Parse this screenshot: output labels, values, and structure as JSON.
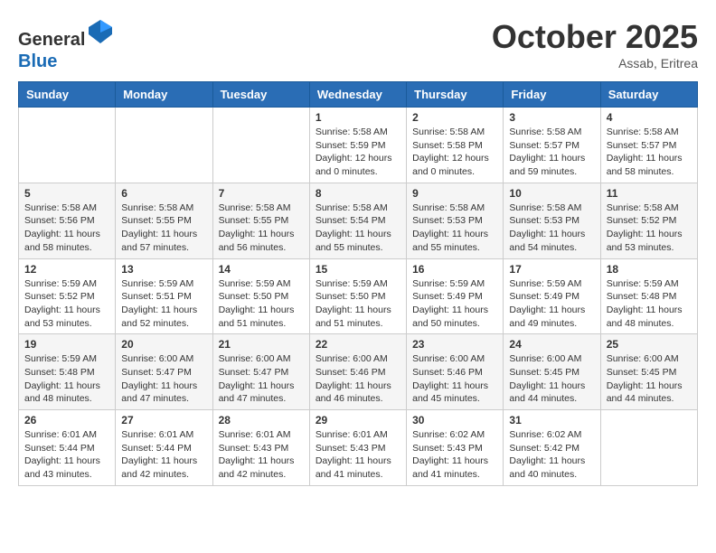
{
  "header": {
    "logo_general": "General",
    "logo_blue": "Blue",
    "month": "October 2025",
    "location": "Assab, Eritrea"
  },
  "weekdays": [
    "Sunday",
    "Monday",
    "Tuesday",
    "Wednesday",
    "Thursday",
    "Friday",
    "Saturday"
  ],
  "weeks": [
    [
      {
        "day": "",
        "content": ""
      },
      {
        "day": "",
        "content": ""
      },
      {
        "day": "",
        "content": ""
      },
      {
        "day": "1",
        "content": "Sunrise: 5:58 AM\nSunset: 5:59 PM\nDaylight: 12 hours\nand 0 minutes."
      },
      {
        "day": "2",
        "content": "Sunrise: 5:58 AM\nSunset: 5:58 PM\nDaylight: 12 hours\nand 0 minutes."
      },
      {
        "day": "3",
        "content": "Sunrise: 5:58 AM\nSunset: 5:57 PM\nDaylight: 11 hours\nand 59 minutes."
      },
      {
        "day": "4",
        "content": "Sunrise: 5:58 AM\nSunset: 5:57 PM\nDaylight: 11 hours\nand 58 minutes."
      }
    ],
    [
      {
        "day": "5",
        "content": "Sunrise: 5:58 AM\nSunset: 5:56 PM\nDaylight: 11 hours\nand 58 minutes."
      },
      {
        "day": "6",
        "content": "Sunrise: 5:58 AM\nSunset: 5:55 PM\nDaylight: 11 hours\nand 57 minutes."
      },
      {
        "day": "7",
        "content": "Sunrise: 5:58 AM\nSunset: 5:55 PM\nDaylight: 11 hours\nand 56 minutes."
      },
      {
        "day": "8",
        "content": "Sunrise: 5:58 AM\nSunset: 5:54 PM\nDaylight: 11 hours\nand 55 minutes."
      },
      {
        "day": "9",
        "content": "Sunrise: 5:58 AM\nSunset: 5:53 PM\nDaylight: 11 hours\nand 55 minutes."
      },
      {
        "day": "10",
        "content": "Sunrise: 5:58 AM\nSunset: 5:53 PM\nDaylight: 11 hours\nand 54 minutes."
      },
      {
        "day": "11",
        "content": "Sunrise: 5:58 AM\nSunset: 5:52 PM\nDaylight: 11 hours\nand 53 minutes."
      }
    ],
    [
      {
        "day": "12",
        "content": "Sunrise: 5:59 AM\nSunset: 5:52 PM\nDaylight: 11 hours\nand 53 minutes."
      },
      {
        "day": "13",
        "content": "Sunrise: 5:59 AM\nSunset: 5:51 PM\nDaylight: 11 hours\nand 52 minutes."
      },
      {
        "day": "14",
        "content": "Sunrise: 5:59 AM\nSunset: 5:50 PM\nDaylight: 11 hours\nand 51 minutes."
      },
      {
        "day": "15",
        "content": "Sunrise: 5:59 AM\nSunset: 5:50 PM\nDaylight: 11 hours\nand 51 minutes."
      },
      {
        "day": "16",
        "content": "Sunrise: 5:59 AM\nSunset: 5:49 PM\nDaylight: 11 hours\nand 50 minutes."
      },
      {
        "day": "17",
        "content": "Sunrise: 5:59 AM\nSunset: 5:49 PM\nDaylight: 11 hours\nand 49 minutes."
      },
      {
        "day": "18",
        "content": "Sunrise: 5:59 AM\nSunset: 5:48 PM\nDaylight: 11 hours\nand 48 minutes."
      }
    ],
    [
      {
        "day": "19",
        "content": "Sunrise: 5:59 AM\nSunset: 5:48 PM\nDaylight: 11 hours\nand 48 minutes."
      },
      {
        "day": "20",
        "content": "Sunrise: 6:00 AM\nSunset: 5:47 PM\nDaylight: 11 hours\nand 47 minutes."
      },
      {
        "day": "21",
        "content": "Sunrise: 6:00 AM\nSunset: 5:47 PM\nDaylight: 11 hours\nand 47 minutes."
      },
      {
        "day": "22",
        "content": "Sunrise: 6:00 AM\nSunset: 5:46 PM\nDaylight: 11 hours\nand 46 minutes."
      },
      {
        "day": "23",
        "content": "Sunrise: 6:00 AM\nSunset: 5:46 PM\nDaylight: 11 hours\nand 45 minutes."
      },
      {
        "day": "24",
        "content": "Sunrise: 6:00 AM\nSunset: 5:45 PM\nDaylight: 11 hours\nand 44 minutes."
      },
      {
        "day": "25",
        "content": "Sunrise: 6:00 AM\nSunset: 5:45 PM\nDaylight: 11 hours\nand 44 minutes."
      }
    ],
    [
      {
        "day": "26",
        "content": "Sunrise: 6:01 AM\nSunset: 5:44 PM\nDaylight: 11 hours\nand 43 minutes."
      },
      {
        "day": "27",
        "content": "Sunrise: 6:01 AM\nSunset: 5:44 PM\nDaylight: 11 hours\nand 42 minutes."
      },
      {
        "day": "28",
        "content": "Sunrise: 6:01 AM\nSunset: 5:43 PM\nDaylight: 11 hours\nand 42 minutes."
      },
      {
        "day": "29",
        "content": "Sunrise: 6:01 AM\nSunset: 5:43 PM\nDaylight: 11 hours\nand 41 minutes."
      },
      {
        "day": "30",
        "content": "Sunrise: 6:02 AM\nSunset: 5:43 PM\nDaylight: 11 hours\nand 41 minutes."
      },
      {
        "day": "31",
        "content": "Sunrise: 6:02 AM\nSunset: 5:42 PM\nDaylight: 11 hours\nand 40 minutes."
      },
      {
        "day": "",
        "content": ""
      }
    ]
  ]
}
